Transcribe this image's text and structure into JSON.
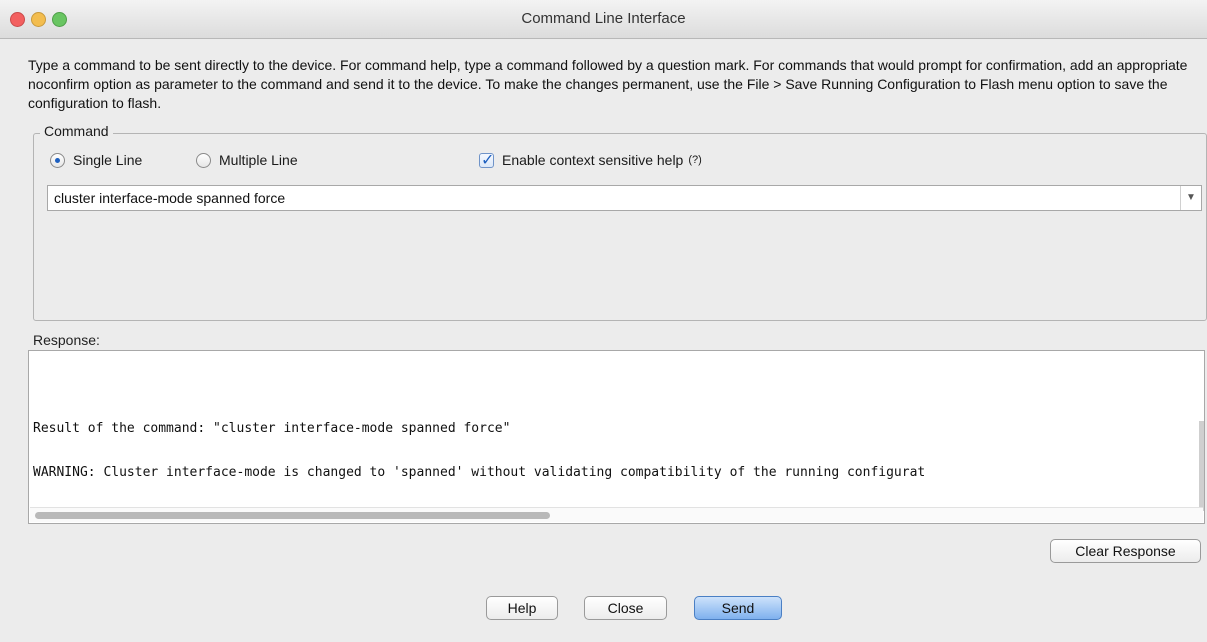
{
  "window": {
    "title": "Command Line Interface"
  },
  "description": "Type a command to be sent directly to the device. For command help, type a command followed by a question mark. For commands that would prompt for confirmation, add an appropriate noconfirm option as parameter to the command and send it to the device. To make the changes permanent, use the File > Save Running Configuration to Flash menu option to save the configuration to flash.",
  "command_group": {
    "legend": "Command",
    "mode_options": [
      {
        "label": "Single Line",
        "selected": true
      },
      {
        "label": "Multiple Line",
        "selected": false
      }
    ],
    "context_help": {
      "label": "Enable context sensitive help",
      "hint": "(?)",
      "checked": true
    },
    "command_value": "cluster interface-mode spanned force"
  },
  "response": {
    "label": "Response:",
    "lines": [
      "Result of the command: \"cluster interface-mode spanned force\"",
      "WARNING: Cluster interface-mode is changed to 'spanned' without validating compatibility of the running configurat"
    ]
  },
  "buttons": {
    "clear_response": "Clear Response",
    "help": "Help",
    "close": "Close",
    "send": "Send"
  },
  "colors": {
    "accent": "#1d5fbf",
    "send_button": "#7fb1ee"
  }
}
